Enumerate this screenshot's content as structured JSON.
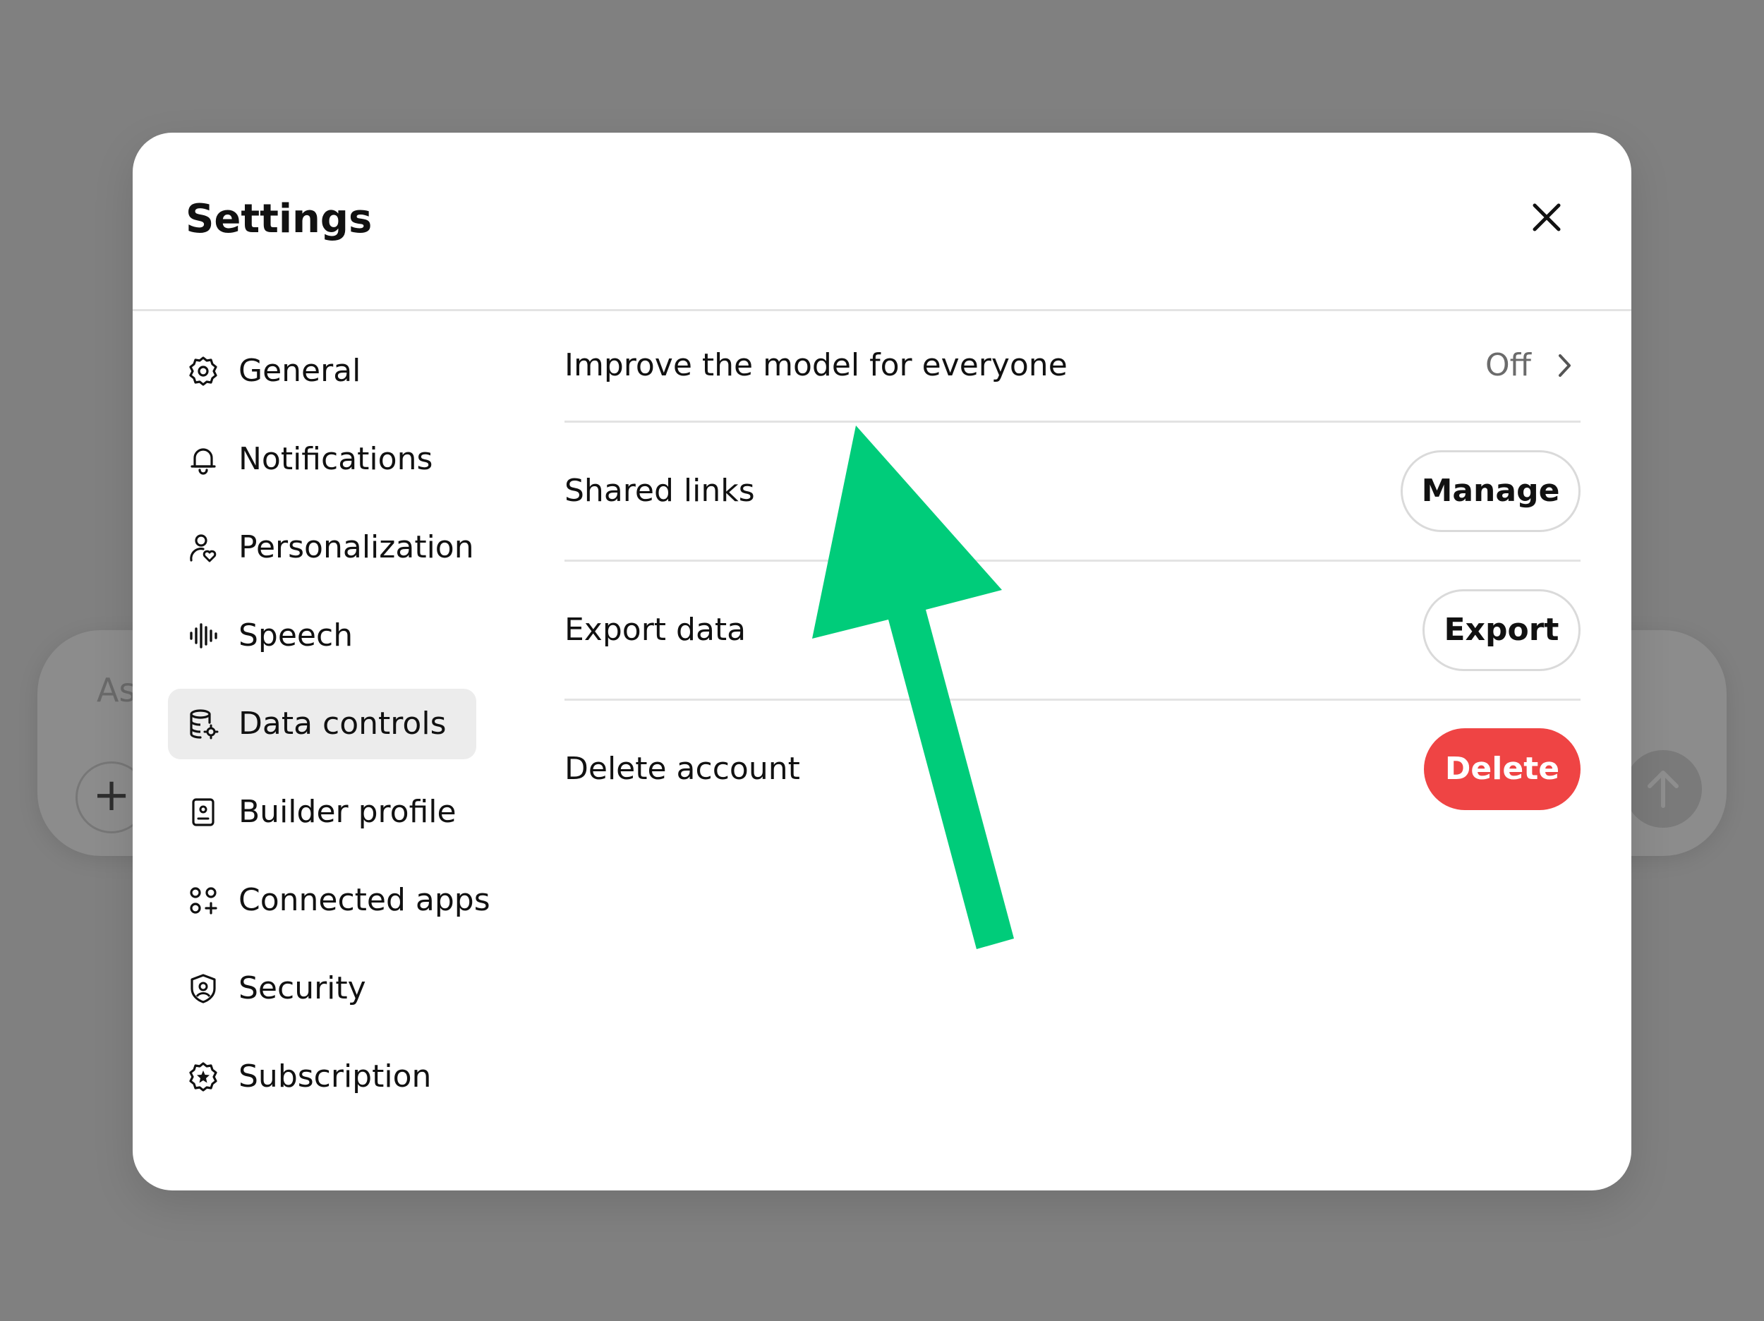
{
  "background": {
    "composer_placeholder": "As"
  },
  "modal": {
    "title": "Settings"
  },
  "sidebar": {
    "items": [
      {
        "label": "General",
        "icon": "gear-icon"
      },
      {
        "label": "Notifications",
        "icon": "bell-icon"
      },
      {
        "label": "Personalization",
        "icon": "person-heart-icon"
      },
      {
        "label": "Speech",
        "icon": "waveform-icon"
      },
      {
        "label": "Data controls",
        "icon": "database-settings-icon",
        "active": true
      },
      {
        "label": "Builder profile",
        "icon": "id-badge-icon"
      },
      {
        "label": "Connected apps",
        "icon": "apps-grid-icon"
      },
      {
        "label": "Security",
        "icon": "shield-user-icon"
      },
      {
        "label": "Subscription",
        "icon": "badge-star-icon"
      }
    ]
  },
  "data_controls": {
    "improve_model": {
      "label": "Improve the model for everyone",
      "value": "Off"
    },
    "shared_links": {
      "label": "Shared links",
      "button": "Manage"
    },
    "export_data": {
      "label": "Export data",
      "button": "Export"
    },
    "delete_account": {
      "label": "Delete account",
      "button": "Delete"
    }
  },
  "colors": {
    "accent_arrow": "#00cc7a",
    "danger": "#ef4444",
    "overlay": "#808080"
  }
}
